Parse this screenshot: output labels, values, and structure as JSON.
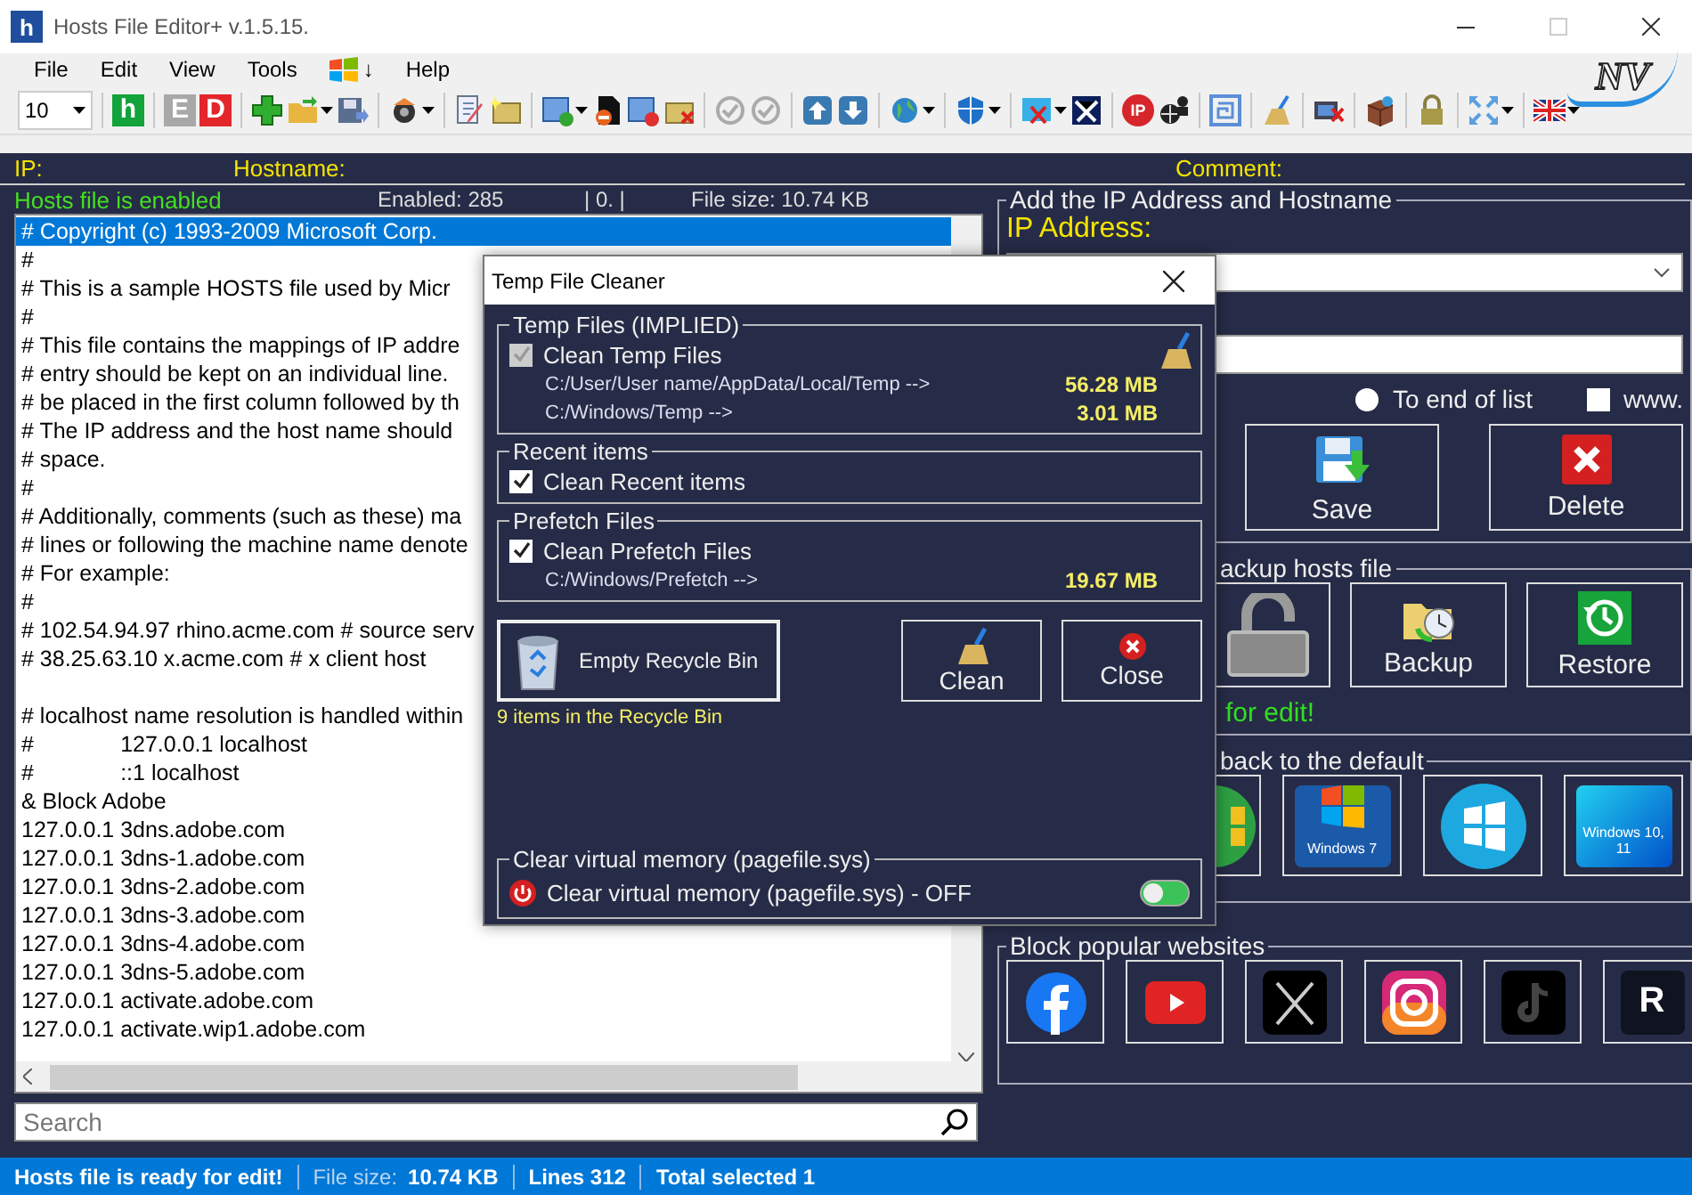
{
  "window": {
    "title": "Hosts File Editor+ v.1.5.15.",
    "app_icon": "h",
    "logo": "NV"
  },
  "menu": [
    {
      "kind": "text",
      "label": "File"
    },
    {
      "kind": "text",
      "label": "Edit"
    },
    {
      "kind": "text",
      "label": "View"
    },
    {
      "kind": "text",
      "label": "Tools"
    },
    {
      "kind": "logo",
      "label": "↓"
    },
    {
      "kind": "text",
      "label": "Help"
    }
  ],
  "toolbar": [
    {
      "kind": "combo",
      "value": "10"
    },
    {
      "kind": "sep"
    },
    {
      "kind": "letter",
      "text": "h",
      "color": "#12a33a"
    },
    {
      "kind": "sep"
    },
    {
      "kind": "letter",
      "text": "E",
      "color": "#a8a8a8"
    },
    {
      "kind": "letter",
      "text": "D",
      "color": "#e3262b"
    },
    {
      "kind": "sep"
    },
    {
      "kind": "plus"
    },
    {
      "kind": "folder",
      "menu": true
    },
    {
      "kind": "save"
    },
    {
      "kind": "sep"
    },
    {
      "kind": "gear",
      "menu": true
    },
    {
      "kind": "sep"
    },
    {
      "kind": "edit"
    },
    {
      "kind": "note"
    },
    {
      "kind": "sep"
    },
    {
      "kind": "window-plus",
      "menu": true
    },
    {
      "kind": "document-minus"
    },
    {
      "kind": "window-minus"
    },
    {
      "kind": "note-x"
    },
    {
      "kind": "sep"
    },
    {
      "kind": "check"
    },
    {
      "kind": "check"
    },
    {
      "kind": "sep"
    },
    {
      "kind": "arrow-up"
    },
    {
      "kind": "arrow-down"
    },
    {
      "kind": "sep"
    },
    {
      "kind": "globe",
      "menu": true
    },
    {
      "kind": "sep"
    },
    {
      "kind": "shield",
      "menu": true
    },
    {
      "kind": "sep"
    },
    {
      "kind": "window-x",
      "menu": true
    },
    {
      "kind": "network"
    },
    {
      "kind": "sep"
    },
    {
      "kind": "badge",
      "text": "IP"
    },
    {
      "kind": "globe-person"
    },
    {
      "kind": "sep"
    },
    {
      "kind": "maze"
    },
    {
      "kind": "sep"
    },
    {
      "kind": "broom"
    },
    {
      "kind": "sep"
    },
    {
      "kind": "monitor-x"
    },
    {
      "kind": "sep"
    },
    {
      "kind": "box"
    },
    {
      "kind": "sep"
    },
    {
      "kind": "lock"
    },
    {
      "kind": "sep"
    },
    {
      "kind": "expand",
      "menu": true
    },
    {
      "kind": "sep"
    },
    {
      "kind": "flag",
      "menu": true
    }
  ],
  "header": {
    "ip": "IP:",
    "hostname": "Hostname:",
    "comment": "Comment:"
  },
  "info": {
    "state": "Hosts file is enabled",
    "enabled": "Enabled: 285",
    "marker": "| 0. |",
    "size": "File size: 10.74 KB"
  },
  "lines": [
    {
      "text": "# Copyright (c) 1993-2009 Microsoft Corp.",
      "selected": true
    },
    {
      "text": "#",
      "selected": false
    },
    {
      "text": "# This is a sample HOSTS file used by Micr",
      "selected": false
    },
    {
      "text": "#",
      "selected": false
    },
    {
      "text": "# This file contains the mappings of IP addre",
      "selected": false
    },
    {
      "text": "# entry should be kept on an individual line.",
      "selected": false
    },
    {
      "text": "# be placed in the first column followed by th",
      "selected": false
    },
    {
      "text": "# The IP address and the host name should",
      "selected": false
    },
    {
      "text": "# space.",
      "selected": false
    },
    {
      "text": "#",
      "selected": false
    },
    {
      "text": "# Additionally, comments (such as these) ma",
      "selected": false
    },
    {
      "text": "# lines or following the machine name denote",
      "selected": false
    },
    {
      "text": "# For example:",
      "selected": false
    },
    {
      "text": "#",
      "selected": false
    },
    {
      "text": "# 102.54.94.97 rhino.acme.com # source serv",
      "selected": false
    },
    {
      "text": "# 38.25.63.10 x.acme.com # x client host",
      "selected": false
    },
    {
      "selected": false
    },
    {
      "text": "# localhost name resolution is handled within",
      "selected": false
    },
    {
      "text": "#              127.0.0.1 localhost",
      "selected": false
    },
    {
      "text": "#              ::1 localhost",
      "selected": false
    },
    {
      "text": "& Block Adobe",
      "selected": false
    },
    {
      "text": "127.0.0.1 3dns.adobe.com",
      "selected": false
    },
    {
      "text": "127.0.0.1 3dns-1.adobe.com",
      "selected": false
    },
    {
      "text": "127.0.0.1 3dns-2.adobe.com",
      "selected": false
    },
    {
      "text": "127.0.0.1 3dns-3.adobe.com",
      "selected": false
    },
    {
      "text": "127.0.0.1 3dns-4.adobe.com",
      "selected": false
    },
    {
      "text": "127.0.0.1 3dns-5.adobe.com",
      "selected": false
    },
    {
      "text": "127.0.0.1 activate.adobe.com",
      "selected": false
    },
    {
      "text": "127.0.0.1 activate.wip1.adobe.com",
      "selected": false
    }
  ],
  "search": {
    "placeholder": "Search"
  },
  "editor": {
    "title": "Add the IP Address  and Hostname",
    "ip_label": "IP Address:",
    "position": {
      "label": "To end of list",
      "selected": false
    },
    "www": {
      "label": "www.",
      "checked": false
    },
    "buttons": [
      {
        "kind": "save",
        "label": "Save"
      },
      {
        "kind": "delete",
        "label": "Delete"
      }
    ]
  },
  "backup": {
    "title": "ackup hosts file",
    "buttons": [
      {
        "kind": "lock"
      },
      {
        "kind": "backup",
        "label": "Backup"
      },
      {
        "kind": "restore",
        "label": "Restore"
      }
    ],
    "note": "for edit!"
  },
  "restore_default": {
    "title": "back to the default",
    "tiles": [
      {
        "kind": "green"
      },
      {
        "kind": "win7",
        "label": "Windows 7"
      },
      {
        "kind": "win8"
      },
      {
        "kind": "win10",
        "label": "Windows 10, 11"
      }
    ]
  },
  "block_sites": {
    "title": "Block popular websites",
    "sites": [
      {
        "kind": "facebook"
      },
      {
        "kind": "youtube"
      },
      {
        "kind": "x"
      },
      {
        "kind": "instagram"
      },
      {
        "kind": "tiktok"
      },
      {
        "kind": "r",
        "label": "R"
      }
    ]
  },
  "dialog": {
    "title": "Temp File Cleaner",
    "groups": [
      {
        "title": "Temp Files (IMPLIED)",
        "broom": true,
        "option": {
          "label": "Clean Temp Files",
          "checked": true,
          "disabled": true
        },
        "paths": [
          {
            "path": "C:/User/User name/AppData/Local/Temp -->",
            "size": "56.28 MB"
          },
          {
            "path": "C:/Windows/Temp -->",
            "size": "3.01 MB"
          }
        ]
      },
      {
        "title": "Recent items",
        "option": {
          "label": "Clean Recent items",
          "checked": true,
          "disabled": false
        }
      },
      {
        "title": "Prefetch Files",
        "option": {
          "label": "Clean Prefetch Files",
          "checked": true,
          "disabled": false
        },
        "paths": [
          {
            "path": "C:/Windows/Prefetch -->",
            "size": "19.67 MB"
          }
        ]
      }
    ],
    "recycle": {
      "label": "Empty  Recycle Bin",
      "note": "9 items in the Recycle Bin"
    },
    "buttons": [
      {
        "kind": "clean",
        "label": "Clean"
      },
      {
        "kind": "close",
        "label": "Close"
      }
    ],
    "memory": {
      "title": "Clear virtual memory (pagefile.sys)",
      "label": "Clear virtual memory (pagefile.sys) - OFF",
      "on": false
    }
  },
  "status_bar": {
    "message": "Hosts file is ready for edit!",
    "items": [
      {
        "label": "File size:",
        "value": "10.74 KB"
      },
      {
        "value": "Lines 312"
      },
      {
        "value": "Total selected 1"
      }
    ]
  }
}
